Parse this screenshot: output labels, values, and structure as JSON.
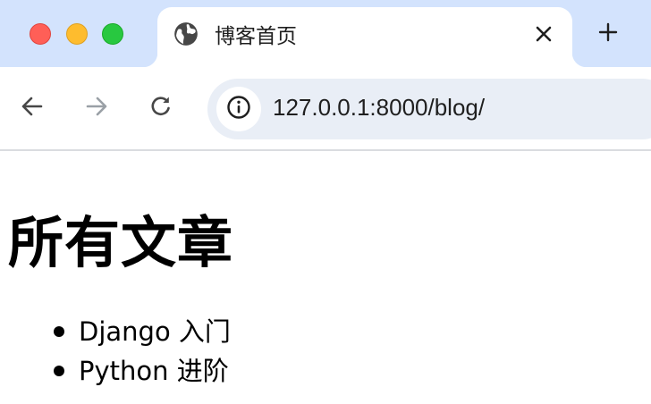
{
  "window": {
    "controls": [
      "close",
      "minimize",
      "maximize"
    ],
    "colors": {
      "close": "#ff5f57",
      "minimize": "#febc2e",
      "maximize": "#28c840"
    }
  },
  "tab": {
    "title": "博客首页",
    "favicon": "globe-icon",
    "close_icon": "close-icon"
  },
  "new_tab": {
    "icon": "plus-icon"
  },
  "toolbar": {
    "back_icon": "arrow-left-icon",
    "forward_icon": "arrow-right-icon",
    "reload_icon": "reload-icon",
    "site_info_icon": "info-icon",
    "url": "127.0.0.1:8000/blog/"
  },
  "page": {
    "heading": "所有文章",
    "posts": [
      {
        "title": "Django 入门"
      },
      {
        "title": "Python 进阶"
      }
    ]
  },
  "colors": {
    "tabstrip_bg": "#d3e3fd",
    "omnibox_bg": "#e9eef6",
    "forward_disabled": "#9aa0a6"
  }
}
